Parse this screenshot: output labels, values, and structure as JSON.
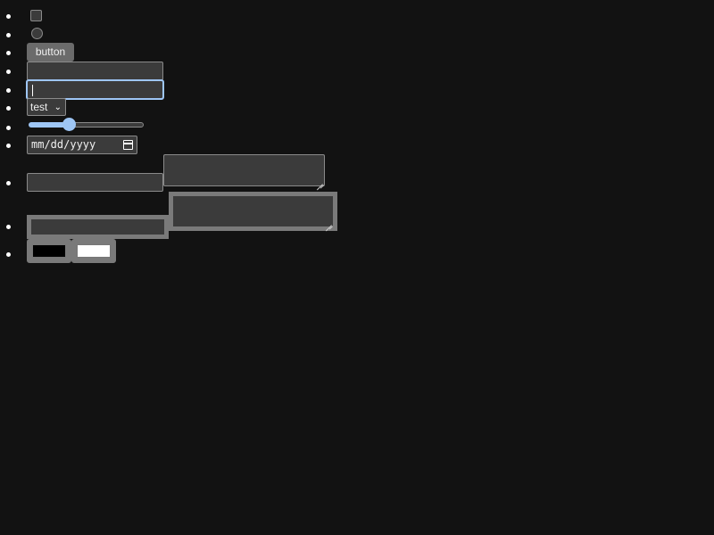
{
  "form": {
    "button_label": "button",
    "select_value": "test",
    "date_placeholder": "mm/dd/yyyy",
    "range_value_percent": 33
  },
  "colors": {
    "background": "#121212",
    "control_fill": "#3b3b3b",
    "control_border": "#8a8a8a",
    "focus_ring": "#9ec6f5",
    "button_fill": "#6b6b6b",
    "thick_border": "#7a7a7a",
    "swatch_1": "#000000",
    "swatch_2": "#ffffff"
  },
  "icons": {
    "select_chevron": "chevron-down-icon",
    "date_picker": "calendar-icon",
    "textarea_resize": "resize-grip-icon"
  }
}
